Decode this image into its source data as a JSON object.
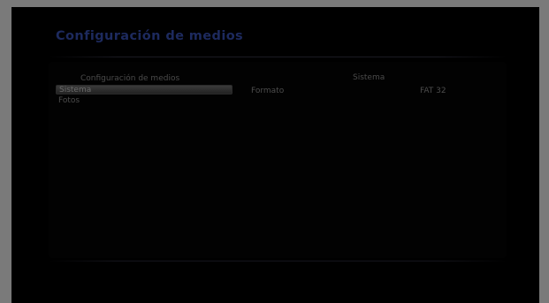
{
  "header": {
    "title": "Configuración de medios"
  },
  "left_column": {
    "header": "Configuración de medios",
    "items": [
      {
        "label": "Sistema",
        "selected": true
      },
      {
        "label": "Fotos",
        "selected": false
      }
    ]
  },
  "right_column": {
    "header": "Sistema",
    "rows": [
      {
        "label": "Formato",
        "value": "FAT 32"
      }
    ]
  },
  "colors": {
    "title": "#1d2a5e",
    "text": "#4d4d4d",
    "background": "#000000",
    "frame": "#7a7a7a"
  }
}
